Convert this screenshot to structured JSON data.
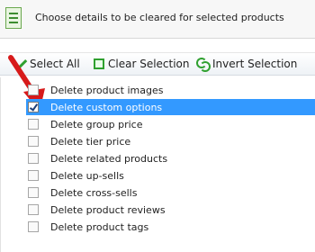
{
  "header": {
    "title": "Choose details to be cleared for selected products"
  },
  "toolbar": {
    "select_all": "Select All",
    "clear_selection": "Clear Selection",
    "invert_selection": "Invert Selection"
  },
  "items": [
    {
      "label": "Delete product images",
      "checked": false
    },
    {
      "label": "Delete custom options",
      "checked": true,
      "selected": true
    },
    {
      "label": "Delete group price",
      "checked": false
    },
    {
      "label": "Delete tier price",
      "checked": false
    },
    {
      "label": "Delete related products",
      "checked": false
    },
    {
      "label": "Delete up-sells",
      "checked": false
    },
    {
      "label": "Delete cross-sells",
      "checked": false
    },
    {
      "label": "Delete product reviews",
      "checked": false
    },
    {
      "label": "Delete product tags",
      "checked": false
    }
  ],
  "colors": {
    "selection": "#3399ff",
    "accent_green": "#2fa02f",
    "arrow_red": "#d71a1a"
  }
}
